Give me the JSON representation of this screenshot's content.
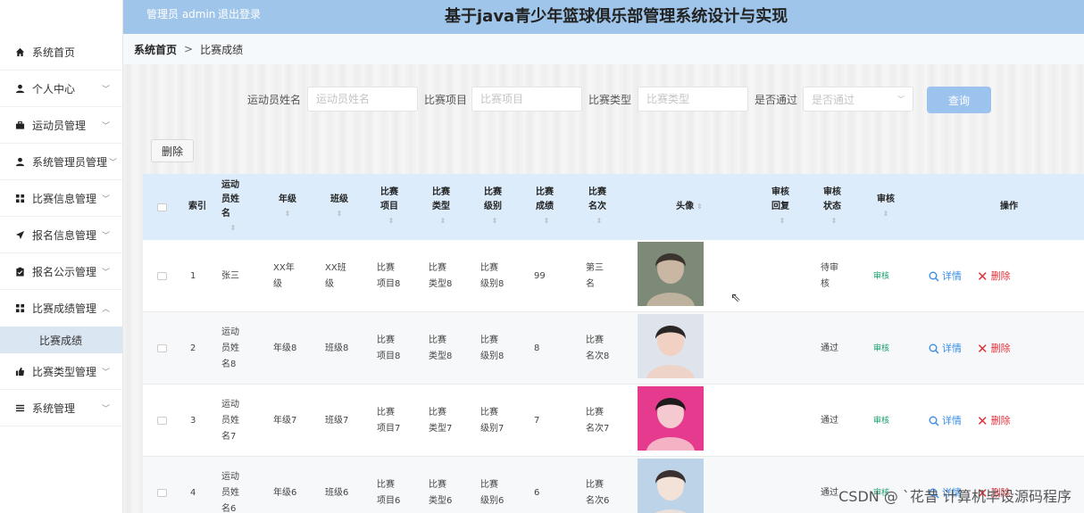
{
  "header": {
    "admin": "管理员 admin",
    "logout": "退出登录",
    "title": "基于java青少年篮球俱乐部管理系统设计与实现"
  },
  "sidebar": {
    "items": [
      {
        "label": "系统首页",
        "icon": "home-icon"
      },
      {
        "label": "个人中心",
        "icon": "user-icon"
      },
      {
        "label": "运动员管理",
        "icon": "briefcase-icon"
      },
      {
        "label": "系统管理员管理",
        "icon": "user-icon"
      },
      {
        "label": "比赛信息管理",
        "icon": "grid-icon"
      },
      {
        "label": "报名信息管理",
        "icon": "send-icon"
      },
      {
        "label": "报名公示管理",
        "icon": "clipboard-icon"
      },
      {
        "label": "比赛成绩管理",
        "icon": "grid-icon"
      },
      {
        "label": "比赛类型管理",
        "icon": "thumb-icon"
      },
      {
        "label": "系统管理",
        "icon": "list-icon"
      }
    ],
    "sub_item": "比赛成绩"
  },
  "breadcrumb": {
    "home": "系统首页",
    "sep": ">",
    "current": "比赛成绩"
  },
  "search": {
    "athlete_label": "运动员姓名",
    "athlete_placeholder": "运动员姓名",
    "project_label": "比赛项目",
    "project_placeholder": "比赛项目",
    "type_label": "比赛类型",
    "type_placeholder": "比赛类型",
    "pass_label": "是否通过",
    "pass_placeholder": "是否通过",
    "query_label": "查询"
  },
  "delete_label": "删除",
  "table": {
    "headers": {
      "index": "索引",
      "name": "运动员姓名",
      "grade": "年级",
      "class": "班级",
      "project": "比赛项目",
      "type": "比赛类型",
      "level": "比赛级别",
      "score": "比赛成绩",
      "rank": "比赛名次",
      "avatar": "头像",
      "reply": "审核回复",
      "status": "审核状态",
      "audit": "审核",
      "ops": "操作"
    },
    "rows": [
      {
        "index": "1",
        "name": "张三",
        "grade": "XX年级",
        "class": "XX班级",
        "project": "比赛项目8",
        "type": "比赛类型8",
        "level": "比赛级别8",
        "score": "99",
        "rank": "第三名",
        "status": "待审核",
        "audit": "审核",
        "detail": "详情",
        "del": "删除"
      },
      {
        "index": "2",
        "name": "运动员姓名8",
        "grade": "年级8",
        "class": "班级8",
        "project": "比赛项目8",
        "type": "比赛类型8",
        "level": "比赛级别8",
        "score": "8",
        "rank": "比赛名次8",
        "status": "通过",
        "audit": "审核",
        "detail": "详情",
        "del": "删除"
      },
      {
        "index": "3",
        "name": "运动员姓名7",
        "grade": "年级7",
        "class": "班级7",
        "project": "比赛项目7",
        "type": "比赛类型7",
        "level": "比赛级别7",
        "score": "7",
        "rank": "比赛名次7",
        "status": "通过",
        "audit": "审核",
        "detail": "详情",
        "del": "删除"
      },
      {
        "index": "4",
        "name": "运动员姓名6",
        "grade": "年级6",
        "class": "班级6",
        "project": "比赛项目6",
        "type": "比赛类型6",
        "level": "比赛级别6",
        "score": "6",
        "rank": "比赛名次6",
        "status": "通过",
        "audit": "审核",
        "detail": "详情",
        "del": "删除"
      }
    ]
  },
  "watermark": "CSDN @ `花昔 计算机毕设源码程序",
  "colors": {
    "header": "#9fc5ea",
    "accent": "#3a8ee6",
    "danger": "#e0323b",
    "audit": "#18a06b"
  }
}
